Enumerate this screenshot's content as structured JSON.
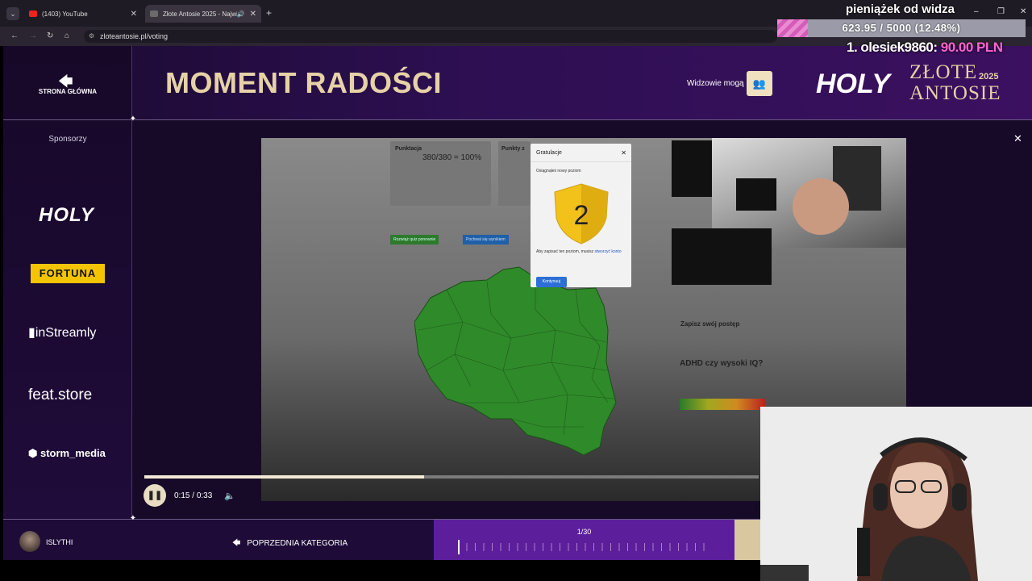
{
  "browser": {
    "tabs": [
      {
        "title": "(1403) YouTube"
      },
      {
        "title": "Złote Antosie 2025 - Najwię"
      }
    ],
    "url": "zloteantosie.pl/voting"
  },
  "overlay": {
    "donation_title": "pieniążek od widza",
    "donation_progress_text": "623.95 / 5000 (12.48%)",
    "donation_fraction": 0.1248,
    "top_donor_name": "1. olesiek9860:",
    "top_donor_amount": "90.00 PLN"
  },
  "sidebar": {
    "home_label": "STRONA GŁÓWNA",
    "sponsors_label": "Sponsorzy",
    "sponsors": [
      "HOLY",
      "FORTUNA",
      "inStreamly",
      "feat.store",
      "storm_media"
    ]
  },
  "header": {
    "category_title": "MOMENT RADOŚCI",
    "viewers_label": "Widzowie mogą",
    "brand": {
      "holy": "HOLY",
      "name_line1": "ZŁOTE",
      "name_line2": "ANTOSIE",
      "year": "2025"
    }
  },
  "video": {
    "modal": {
      "title": "Gratulacje",
      "subtitle": "Osiągnąłeś nowy poziom",
      "level": "2",
      "message": "Aby zapisać ten poziom, musisz",
      "link": "stworzyć konto",
      "button": "Kontynuuj"
    },
    "card_title": "Punktacja",
    "card_score": "380/380 = 100%",
    "card2_title": "Punkty z",
    "btn_green": "Rozwiąż quiz ponownie",
    "btn_blue": "Pochwal się wynikiem",
    "side_save": "Zapisz swój postęp",
    "side_quiz": "ADHD czy wysoki IQ?",
    "current_time": "0:15",
    "duration": "0:33",
    "progress_fraction": 0.455
  },
  "footer": {
    "username": "ISLYTHI",
    "prev_category": "POPRZEDNIA KATEGORIA",
    "category_counter": "1/30"
  },
  "colors": {
    "gold": "#e6d2a6",
    "purple_bar": "#5d1e9c",
    "donation_pink": "#ff63d1",
    "map_green": "#2f8a2a"
  }
}
